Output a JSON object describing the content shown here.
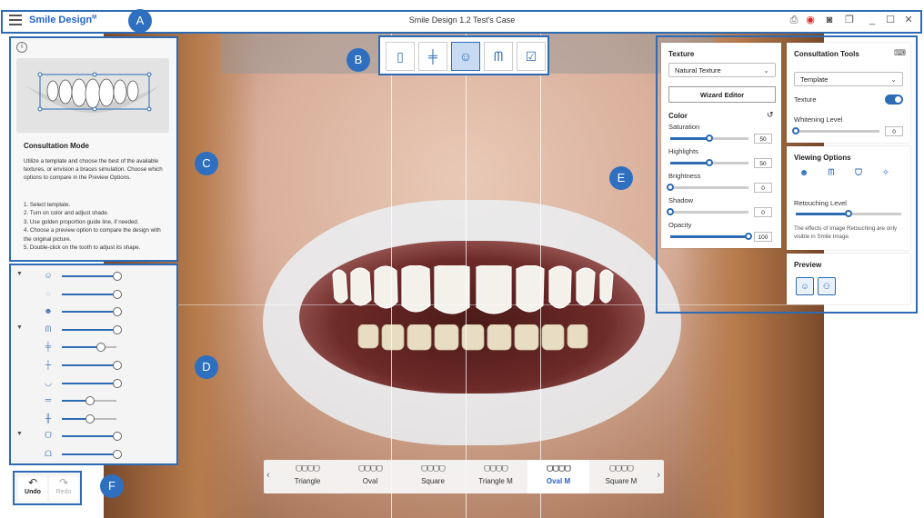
{
  "titlebar": {
    "app_name": "Smile Design",
    "app_name_sup": "M",
    "window_title": "Smile Design 1.2 Test's Case",
    "icons": [
      "export-icon",
      "record-icon",
      "camera-icon",
      "window-icon",
      "minimize-icon",
      "maximize-icon",
      "close-icon"
    ]
  },
  "consultation": {
    "title": "Consultation Mode",
    "body": "Utilize a template and choose the best of the available textures, or envision a braces simulation. Choose which options to compare in the Preview Options.",
    "steps": [
      "1. Select template.",
      "2. Turn on color and adjust shade.",
      "3. Use golden proportion guide line, if needed.",
      "4. Choose a preview option to compare the design with the original picture.",
      "5. Double-click on the tooth to adjust its shape."
    ]
  },
  "sliders_panel": {
    "rows": [
      {
        "icon": "face-icon",
        "expand": true,
        "value": 1.0
      },
      {
        "icon": "face-outline-icon",
        "expand": false,
        "value": 1.0
      },
      {
        "icon": "face-front-icon",
        "expand": false,
        "value": 1.0
      },
      {
        "icon": "teeth-row-icon",
        "expand": true,
        "value": 1.0
      },
      {
        "icon": "midline-icon",
        "expand": false,
        "value": 0.7
      },
      {
        "icon": "crosshair-icon",
        "expand": false,
        "value": 1.0
      },
      {
        "icon": "lip-icon",
        "expand": false,
        "value": 1.0
      },
      {
        "icon": "gum-icon",
        "expand": false,
        "value": 0.5
      },
      {
        "icon": "tooth-length-icon",
        "expand": false,
        "value": 0.5
      },
      {
        "icon": "arch-icon",
        "expand": true,
        "value": 1.0
      },
      {
        "icon": "lower-arch-icon",
        "expand": false,
        "value": 1.0
      }
    ]
  },
  "undo_redo": {
    "undo": "Undo",
    "redo": "Redo"
  },
  "toolbar": {
    "tools": [
      {
        "name": "photo-tool",
        "glyph": "▯"
      },
      {
        "name": "guideline-tool",
        "glyph": "╪"
      },
      {
        "name": "consultation-tool",
        "glyph": "☺"
      },
      {
        "name": "teeth-tool",
        "glyph": "ᗰ"
      },
      {
        "name": "confirm-tool",
        "glyph": "☑"
      }
    ],
    "active_index": 2
  },
  "shapes": {
    "items": [
      "Triangle",
      "Oval",
      "Square",
      "Triangle M",
      "Oval M",
      "Square M"
    ],
    "active": "Oval M",
    "glyph": "ᗜᗜᗜᗜ"
  },
  "texture_card": {
    "title": "Texture",
    "dropdown": "Natural Texture",
    "wizard_button": "Wizard Editor",
    "color_title": "Color",
    "sliders": [
      {
        "label": "Saturation",
        "value": "50",
        "fraction": 0.5
      },
      {
        "label": "Highlights",
        "value": "50",
        "fraction": 0.5
      },
      {
        "label": "Brightness",
        "value": "0",
        "fraction": 0.0
      },
      {
        "label": "Shadow",
        "value": "0",
        "fraction": 0.0
      },
      {
        "label": "Opacity",
        "value": "100",
        "fraction": 1.0
      }
    ]
  },
  "consultation_tools": {
    "title": "Consultation Tools",
    "dropdown": "Template",
    "texture_label": "Texture",
    "whitening_label": "Whitening Level",
    "whitening_value": "0",
    "whitening_fraction": 0.0
  },
  "viewing_options": {
    "title": "Viewing Options",
    "icons": [
      "view-face-icon",
      "view-teeth-icon",
      "view-arch-icon",
      "view-sparkle-icon"
    ],
    "retouching_label": "Retouching Level",
    "retouching_fraction": 0.5,
    "note": "The effects of Image Retouching are only visible in Smile Image."
  },
  "preview": {
    "title": "Preview",
    "icons": [
      "preview-single-icon",
      "preview-compare-icon"
    ]
  },
  "callouts": [
    "A",
    "B",
    "C",
    "D",
    "E",
    "F"
  ],
  "colors": {
    "accent": "#2d6bb4",
    "badge": "#2f6fc0"
  }
}
